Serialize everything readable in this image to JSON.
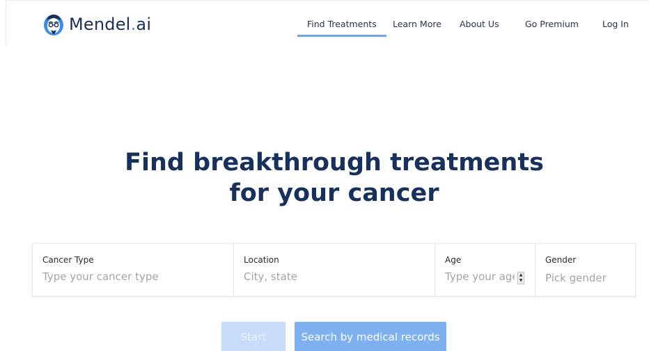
{
  "brand": {
    "name": "Mendel",
    "dot": ".",
    "suffix": "ai",
    "logo_icon": "doctor-face-icon",
    "colors": {
      "navy": "#1b2e57",
      "accent": "#3d8ce6"
    }
  },
  "nav": {
    "items": [
      {
        "label": "Find Treatments",
        "active": true
      },
      {
        "label": "Learn More",
        "active": false
      },
      {
        "label": "About Us",
        "active": false
      },
      {
        "label": "Go Premium",
        "active": false
      },
      {
        "label": "Log In",
        "active": false
      }
    ]
  },
  "hero": {
    "title_line1": "Find breakthrough treatments",
    "title_line2": "for your cancer"
  },
  "search": {
    "cancer": {
      "label": "Cancer Type",
      "placeholder": "Type your cancer type"
    },
    "location": {
      "label": "Location",
      "placeholder": "City, state"
    },
    "age": {
      "label": "Age",
      "placeholder": "Type your age"
    },
    "gender": {
      "label": "Gender",
      "placeholder": "Pick gender"
    }
  },
  "actions": {
    "start_label": "Start",
    "records_label": "Search by medical records",
    "colors": {
      "start_disabled_bg": "#c7dcf9",
      "records_bg": "#7fb0f2"
    }
  }
}
